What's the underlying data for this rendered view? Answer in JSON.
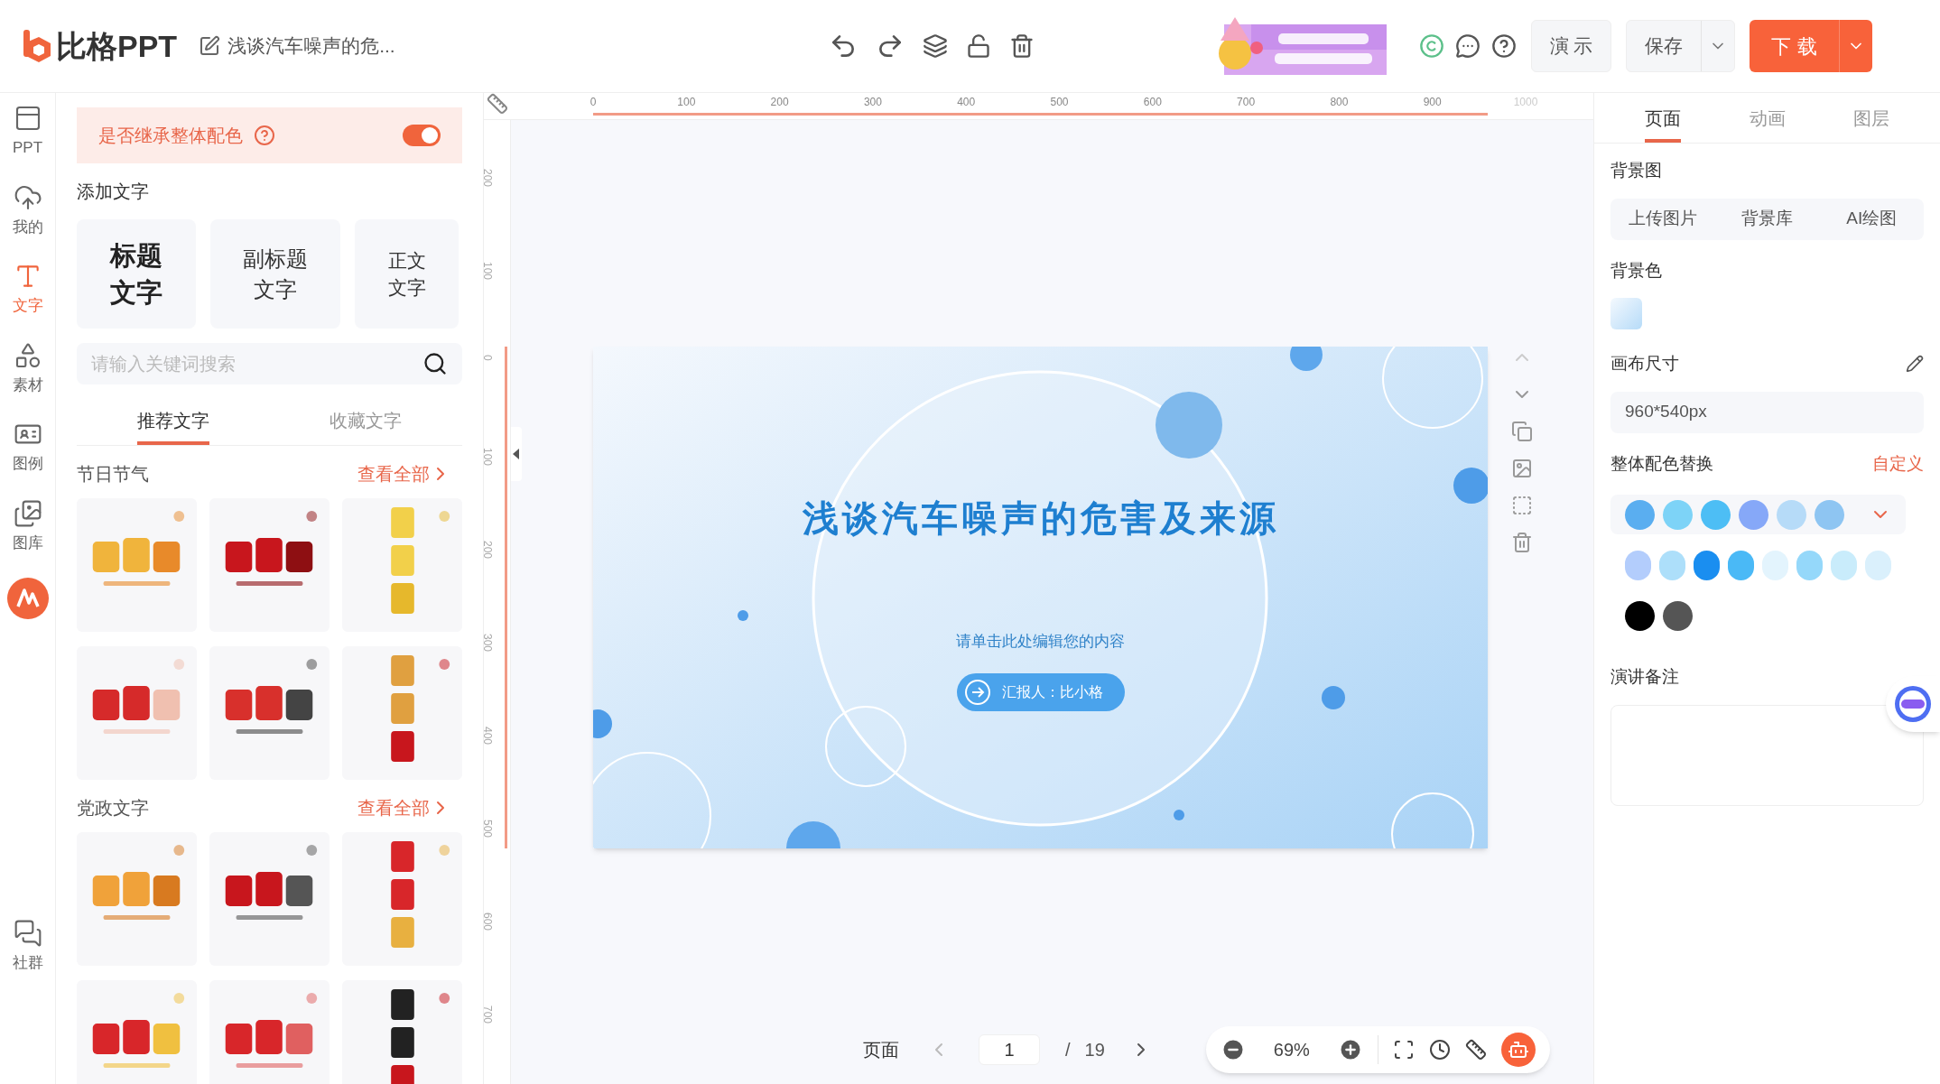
{
  "header": {
    "logo_text": "比格PPT",
    "doc_title": "浅谈汽车噪声的危...",
    "buttons": [
      {
        "label": "演 示",
        "kind": "plain"
      },
      {
        "label": "保存",
        "kind": "split"
      },
      {
        "label": "下 载",
        "kind": "primary"
      }
    ]
  },
  "rail": [
    {
      "label": "PPT",
      "selected": false
    },
    {
      "label": "我的",
      "selected": false
    },
    {
      "label": "文字",
      "selected": true
    },
    {
      "label": "素材",
      "selected": false
    },
    {
      "label": "图例",
      "selected": false
    },
    {
      "label": "图库",
      "selected": false
    },
    {
      "label": "社群",
      "selected": false
    }
  ],
  "inherit_color": {
    "label": "是否继承整体配色",
    "on": true
  },
  "add_text": {
    "title": "添加文字",
    "cards": [
      {
        "lines": [
          "标题",
          "文字"
        ],
        "kind": "title"
      },
      {
        "lines": [
          "副标题",
          "文字"
        ],
        "kind": "subtitle"
      },
      {
        "lines": [
          "正文",
          "文字"
        ],
        "kind": "body"
      }
    ]
  },
  "search": {
    "placeholder": "请输入关键词搜索"
  },
  "text_tabs": [
    {
      "label": "推荐文字",
      "selected": true
    },
    {
      "label": "收藏文字",
      "selected": false
    }
  ],
  "sections": [
    {
      "title": "节日节气",
      "link": "查看全部"
    },
    {
      "title": "党政文字",
      "link": "查看全部"
    }
  ],
  "ruler": {
    "x_labels": [
      "0",
      "100",
      "200",
      "300",
      "400",
      "500",
      "600",
      "700",
      "800",
      "900",
      "1000"
    ],
    "y_labels": [
      "200",
      "100",
      "0",
      "100",
      "200",
      "300",
      "400",
      "500",
      "600",
      "700"
    ]
  },
  "slide": {
    "title": "浅谈汽车噪声的危害及来源",
    "subtitle": "请单击此处编辑您的内容",
    "reporter": "汇报人：比小格"
  },
  "pager": {
    "label": "页面",
    "current": "1",
    "separator": "/",
    "total": "19"
  },
  "zoom": {
    "value": "69%"
  },
  "right_panel": {
    "tabs": [
      {
        "label": "页面",
        "selected": true
      },
      {
        "label": "动画",
        "selected": false
      },
      {
        "label": "图层",
        "selected": false
      }
    ],
    "bg_image": {
      "title": "背景图",
      "buttons": [
        "上传图片",
        "背景库",
        "AI绘图"
      ]
    },
    "bg_color": {
      "title": "背景色"
    },
    "canvas_size": {
      "title": "画布尺寸",
      "value": "960*540px"
    },
    "palette": {
      "title": "整体配色替换",
      "link": "自定义",
      "rows": [
        [
          {
            "color": "#5aaef0"
          },
          {
            "color": "#7dd3f7"
          },
          {
            "color": "#4dbef5"
          },
          {
            "color": "#86a8f8"
          },
          {
            "color": "#b6dbf8"
          },
          {
            "color": "#8ec5f2"
          }
        ],
        [
          {
            "color": "#b3cdfc"
          },
          {
            "color": "#addffa"
          },
          {
            "color": "#1a8ef0"
          },
          {
            "color": "#4ab9f6"
          },
          {
            "color": "#e3f4fd"
          },
          {
            "color": "#95d8fa"
          },
          {
            "color": "#c9ecfb"
          },
          {
            "color": "#daf0fc"
          }
        ],
        [
          {
            "color": "#000000"
          },
          {
            "color": "#555555"
          }
        ]
      ]
    },
    "notes": {
      "title": "演讲备注"
    }
  }
}
